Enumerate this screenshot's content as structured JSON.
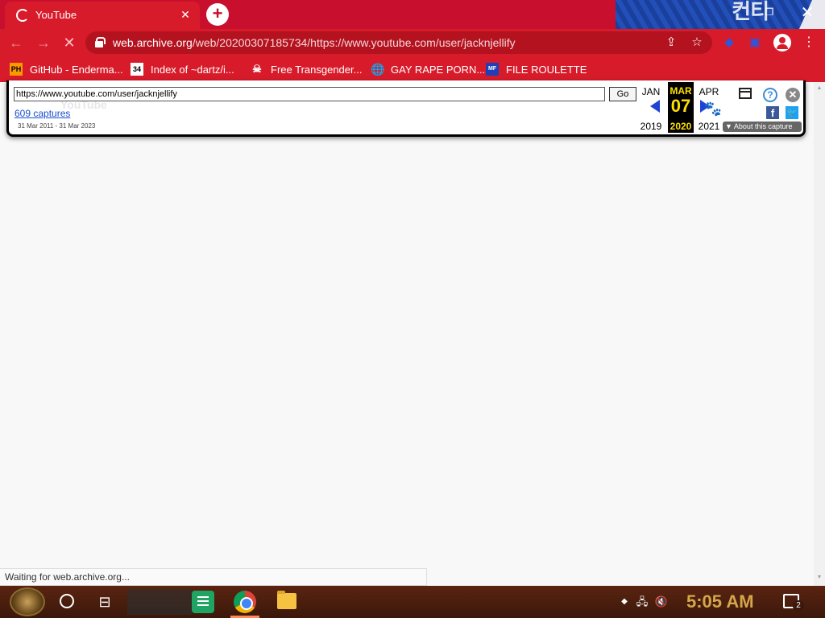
{
  "browser": {
    "tab": {
      "title": "YouTube"
    },
    "url_host": "web.archive.org",
    "url_path": "/web/20200307185734/https://www.youtube.com/user/jacknjellify",
    "bookmarks": [
      {
        "label": "GitHub - Enderma...",
        "icon": "PH"
      },
      {
        "label": "Index of ~dartz/i...",
        "icon": "34"
      },
      {
        "label": "Free Transgender...",
        "icon": "skull"
      },
      {
        "label": "GAY RAPE PORN...",
        "icon": "globe"
      },
      {
        "label": "FILE ROULETTE",
        "icon": "MF"
      }
    ],
    "status": "Waiting for web.archive.org..."
  },
  "wayback": {
    "url_value": "https://www.youtube.com/user/jacknjellify",
    "go_label": "Go",
    "captures_label": "609 captures",
    "date_range": "31 Mar 2011 - 31 Mar 2023",
    "prev": {
      "month": "JAN",
      "year": "2019"
    },
    "current": {
      "month": "MAR",
      "day": "07",
      "year": "2020"
    },
    "next": {
      "month": "APR",
      "year": "2021"
    },
    "about_label": "About this capture",
    "background_logo_text": "YouTube"
  },
  "taskbar": {
    "clock": "5:05 AM",
    "notification_count": "2"
  },
  "colors": {
    "chrome_theme": "#d81b2a",
    "wayback_highlight": "#ffde00",
    "clock": "#d5a64a"
  }
}
